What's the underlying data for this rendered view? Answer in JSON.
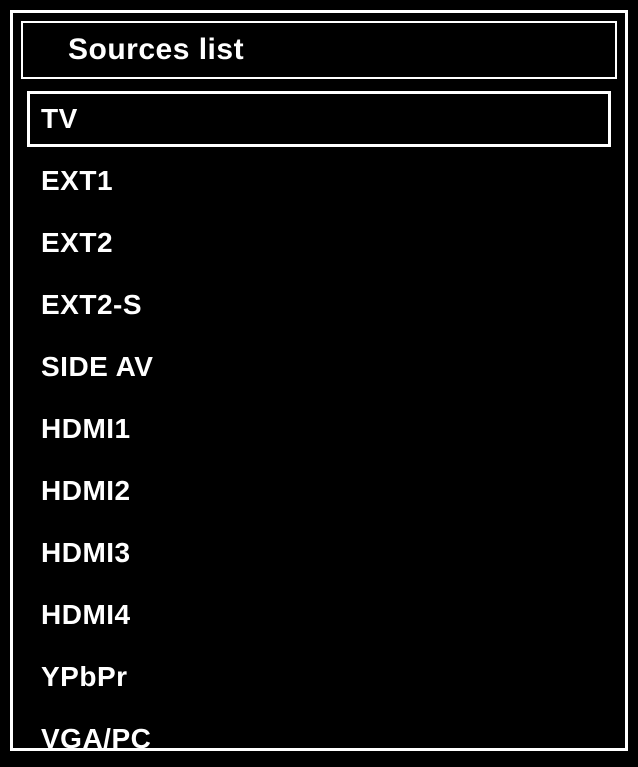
{
  "title": "Sources list",
  "sources": [
    {
      "label": "TV",
      "selected": true
    },
    {
      "label": "EXT1",
      "selected": false
    },
    {
      "label": "EXT2",
      "selected": false
    },
    {
      "label": "EXT2-S",
      "selected": false
    },
    {
      "label": "SIDE AV",
      "selected": false
    },
    {
      "label": "HDMI1",
      "selected": false
    },
    {
      "label": "HDMI2",
      "selected": false
    },
    {
      "label": "HDMI3",
      "selected": false
    },
    {
      "label": "HDMI4",
      "selected": false
    },
    {
      "label": "YPbPr",
      "selected": false
    },
    {
      "label": "VGA/PC",
      "selected": false
    }
  ]
}
